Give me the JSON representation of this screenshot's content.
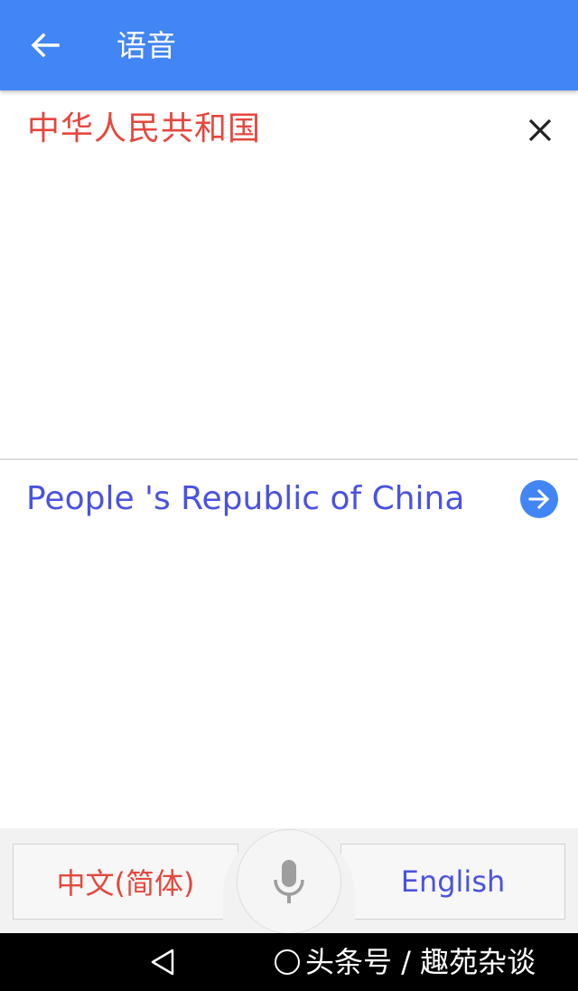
{
  "appbar": {
    "title": "语音",
    "back_icon": "arrow-left-icon",
    "color": "#4285f4"
  },
  "source": {
    "text": "中华人民共和国",
    "text_color": "#e5473d",
    "clear_icon": "close-icon"
  },
  "result": {
    "text": "People 's Republic of China",
    "text_color": "#4a52e0",
    "open_icon": "arrow-right-circle-icon"
  },
  "languages": {
    "source_label": "中文(简体)",
    "target_label": "English",
    "mic_icon": "microphone-icon"
  },
  "system_nav": {
    "back_icon": "triangle-back-icon"
  },
  "watermark": {
    "text": "头条号 / 趣苑杂谈"
  }
}
